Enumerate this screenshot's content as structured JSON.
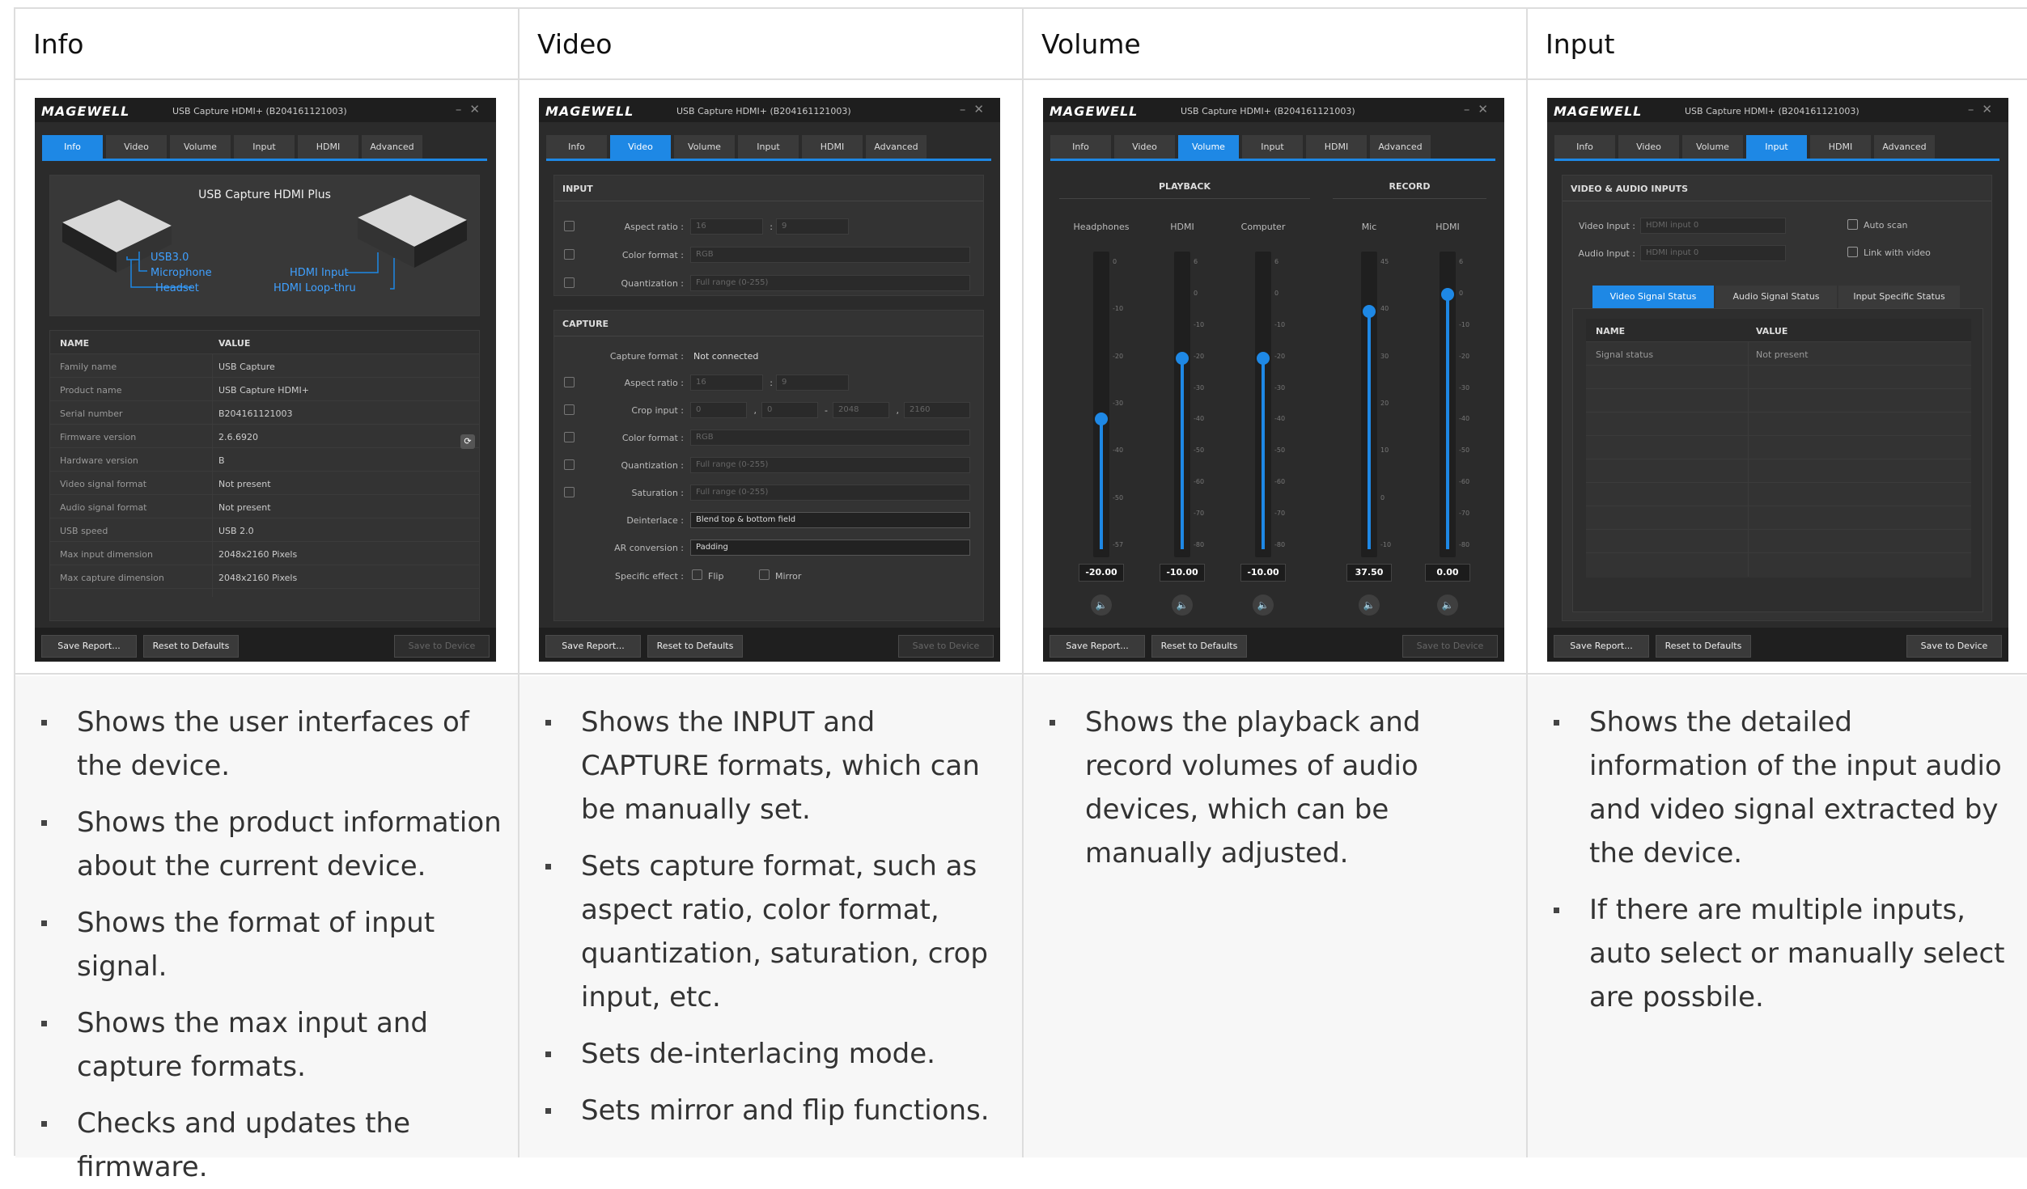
{
  "columns": [
    {
      "title": "Info",
      "bullets": [
        "Shows the user interfaces of the device.",
        "Shows the product information about the current device.",
        "Shows the format of input signal.",
        "Shows the max input and capture formats.",
        "Checks and updates the firmware."
      ]
    },
    {
      "title": "Video",
      "bullets": [
        "Shows the INPUT and CAPTURE formats, which can be manually set.",
        "Sets capture format, such as aspect ratio, color format, quantization, saturation, crop input, etc.",
        "Sets de-interlacing mode.",
        "Sets mirror and flip functions."
      ]
    },
    {
      "title": "Volume",
      "bullets": [
        "Shows the playback and record volumes of audio devices, which can be manually adjusted."
      ]
    },
    {
      "title": "Input",
      "bullets": [
        "Shows the detailed information of the input audio and video signal extracted by the device.",
        "If there are multiple inputs, auto select or manually select are possbile."
      ]
    }
  ],
  "app": {
    "logo": "MAGEWELL",
    "device": "USB Capture HDMI+ (B204161121003)",
    "tabs": [
      "Info",
      "Video",
      "Volume",
      "Input",
      "HDMI",
      "Advanced"
    ],
    "save_report": "Save Report...",
    "reset": "Reset to Defaults",
    "save_device": "Save to Device",
    "accent": "#1e88e5"
  },
  "info": {
    "diagram_title": "USB Capture HDMI Plus",
    "labels": [
      "USB3.0",
      "Microphone",
      "Headset",
      "HDMI Input",
      "HDMI Loop-thru"
    ],
    "col_name": "NAME",
    "col_value": "VALUE",
    "rows": [
      [
        "Family name",
        "USB Capture"
      ],
      [
        "Product name",
        "USB Capture HDMI+"
      ],
      [
        "Serial number",
        "B204161121003"
      ],
      [
        "Firmware version",
        "2.6.6920"
      ],
      [
        "Hardware version",
        "B"
      ],
      [
        "Video signal format",
        "Not present"
      ],
      [
        "Audio signal format",
        "Not present"
      ],
      [
        "USB speed",
        "USB 2.0"
      ],
      [
        "Max input dimension",
        "2048x2160 Pixels"
      ],
      [
        "Max capture dimension",
        "2048x2160 Pixels"
      ]
    ]
  },
  "video": {
    "input_title": "INPUT",
    "capture_title": "CAPTURE",
    "aspect": "Aspect ratio :",
    "color": "Color format :",
    "quant": "Quantization :",
    "capfmt": "Capture format :",
    "capfmt_val": "Not connected",
    "crop": "Crop input :",
    "sat": "Saturation :",
    "deint": "Deinterlace :",
    "deint_val": "Blend top & bottom field",
    "arconv": "AR conversion :",
    "arconv_val": "Padding",
    "effect": "Specific effect :",
    "flip": "Flip",
    "mirror": "Mirror",
    "v16": "16",
    "v9": "9",
    "rgb": "RGB",
    "full": "Full range (0-255)",
    "c0": "0",
    "c2048": "2048",
    "c2160": "2160",
    "colon": ":",
    "comma": ",",
    "dash": "-"
  },
  "volume": {
    "playback": "PLAYBACK",
    "record": "RECORD",
    "channels": [
      {
        "name": "Headphones",
        "value": "-20.00",
        "level": 0.45
      },
      {
        "name": "HDMI",
        "value": "-10.00",
        "level": 0.66
      },
      {
        "name": "Computer",
        "value": "-10.00",
        "level": 0.66
      },
      {
        "name": "Mic",
        "value": "37.50",
        "level": 0.82
      },
      {
        "name": "HDMI",
        "value": "0.00",
        "level": 0.88
      }
    ]
  },
  "input": {
    "section": "VIDEO & AUDIO INPUTS",
    "video_input": "Video Input :",
    "video_val": "HDMI input 0",
    "audio_input": "Audio Input :",
    "audio_val": "HDMI input 0",
    "auto_scan": "Auto scan",
    "link_video": "Link with video",
    "subtabs": [
      "Video Signal Status",
      "Audio Signal Status",
      "Input Specific Status"
    ],
    "col_name": "NAME",
    "col_value": "VALUE",
    "row_name": "Signal status",
    "row_value": "Not present"
  }
}
